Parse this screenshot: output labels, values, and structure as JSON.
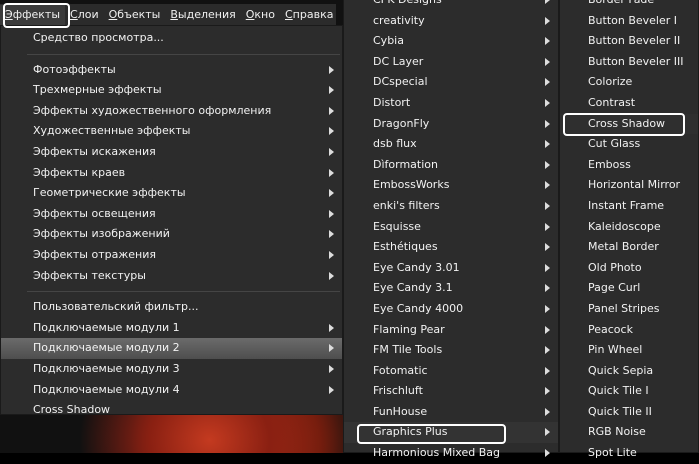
{
  "menubar": {
    "items": [
      "Эффекты",
      "Слои",
      "Объекты",
      "Выделения",
      "Окно",
      "Справка"
    ]
  },
  "effects_menu": {
    "items": [
      {
        "label": "Средство просмотра...",
        "submenu": false
      },
      {
        "sep": true
      },
      {
        "label": "Фотоэффекты",
        "submenu": true
      },
      {
        "label": "Трехмерные эффекты",
        "submenu": true
      },
      {
        "label": "Эффекты художественного оформления",
        "submenu": true
      },
      {
        "label": "Художественные эффекты",
        "submenu": true
      },
      {
        "label": "Эффекты искажения",
        "submenu": true
      },
      {
        "label": "Эффекты краев",
        "submenu": true
      },
      {
        "label": "Геометрические эффекты",
        "submenu": true
      },
      {
        "label": "Эффекты освещения",
        "submenu": true
      },
      {
        "label": "Эффекты изображений",
        "submenu": true
      },
      {
        "label": "Эффекты отражения",
        "submenu": true
      },
      {
        "label": "Эффекты текстуры",
        "submenu": true
      },
      {
        "sep": true
      },
      {
        "label": "Пользовательский фильтр...",
        "submenu": false
      },
      {
        "label": "Подключаемые модули 1",
        "submenu": true
      },
      {
        "label": "Подключаемые модули 2",
        "submenu": true,
        "selected": true
      },
      {
        "label": "Подключаемые модули 3",
        "submenu": true
      },
      {
        "label": "Подключаемые модули 4",
        "submenu": true
      },
      {
        "label": "Cross Shadow",
        "submenu": false
      }
    ]
  },
  "plugins_menu": {
    "items": [
      {
        "label": "CPK Designs",
        "submenu": true
      },
      {
        "label": "creativity",
        "submenu": true
      },
      {
        "label": "Cybia",
        "submenu": true
      },
      {
        "label": "DC Layer",
        "submenu": true
      },
      {
        "label": "DCspecial",
        "submenu": true
      },
      {
        "label": "Distort",
        "submenu": true
      },
      {
        "label": "DragonFly",
        "submenu": true
      },
      {
        "label": "dsb flux",
        "submenu": true
      },
      {
        "label": "Dìformation",
        "submenu": true
      },
      {
        "label": "EmbossWorks",
        "submenu": true
      },
      {
        "label": "enki's filters",
        "submenu": true
      },
      {
        "label": "Esquisse",
        "submenu": true
      },
      {
        "label": "Esthétiques",
        "submenu": true
      },
      {
        "label": "Eye Candy 3.01",
        "submenu": true
      },
      {
        "label": "Eye Candy 3.1",
        "submenu": true
      },
      {
        "label": "Eye Candy 4000",
        "submenu": true
      },
      {
        "label": "Flaming Pear",
        "submenu": true
      },
      {
        "label": "FM Tile Tools",
        "submenu": true
      },
      {
        "label": "Fotomatic",
        "submenu": true
      },
      {
        "label": "Frischluft",
        "submenu": true
      },
      {
        "label": "FunHouse",
        "submenu": true
      },
      {
        "label": "Graphics Plus",
        "submenu": true,
        "selected": true
      },
      {
        "label": "Harmonious Mixed Bag",
        "submenu": true
      }
    ]
  },
  "graphics_plus_menu": {
    "items": [
      {
        "label": "Border Fade"
      },
      {
        "label": "Button Beveler I"
      },
      {
        "label": "Button Beveler II"
      },
      {
        "label": "Button Beveler III"
      },
      {
        "label": "Colorize"
      },
      {
        "label": "Contrast"
      },
      {
        "label": "Cross Shadow",
        "selected": true
      },
      {
        "label": "Cut Glass"
      },
      {
        "label": "Emboss"
      },
      {
        "label": "Horizontal Mirror"
      },
      {
        "label": "Instant Frame"
      },
      {
        "label": "Kaleidoscope"
      },
      {
        "label": "Metal Border"
      },
      {
        "label": "Old Photo"
      },
      {
        "label": "Page Curl"
      },
      {
        "label": "Panel Stripes"
      },
      {
        "label": "Peacock"
      },
      {
        "label": "Pin Wheel"
      },
      {
        "label": "Quick Sepia"
      },
      {
        "label": "Quick Tile I"
      },
      {
        "label": "Quick Tile II"
      },
      {
        "label": "RGB Noise"
      },
      {
        "label": "Spot Lite"
      }
    ]
  }
}
